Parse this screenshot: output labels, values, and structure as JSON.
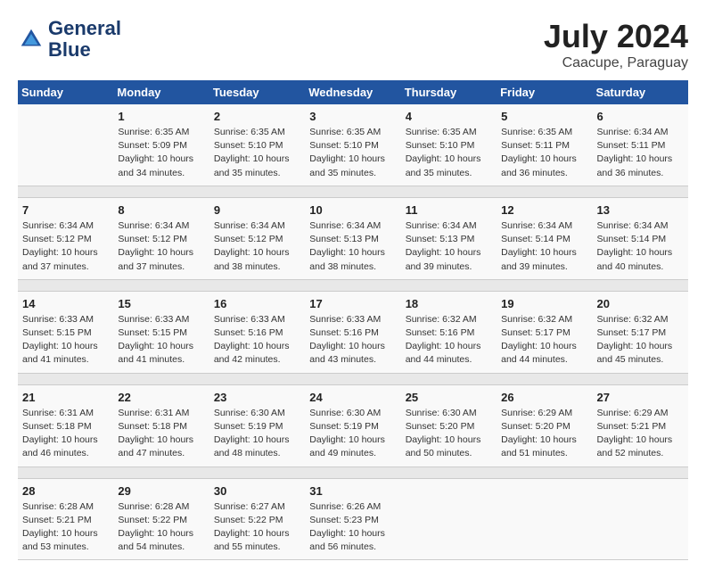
{
  "header": {
    "logo_line1": "General",
    "logo_line2": "Blue",
    "month": "July 2024",
    "location": "Caacupe, Paraguay"
  },
  "weekdays": [
    "Sunday",
    "Monday",
    "Tuesday",
    "Wednesday",
    "Thursday",
    "Friday",
    "Saturday"
  ],
  "weeks": [
    [
      {
        "day": "",
        "info": ""
      },
      {
        "day": "1",
        "info": "Sunrise: 6:35 AM\nSunset: 5:09 PM\nDaylight: 10 hours\nand 34 minutes."
      },
      {
        "day": "2",
        "info": "Sunrise: 6:35 AM\nSunset: 5:10 PM\nDaylight: 10 hours\nand 35 minutes."
      },
      {
        "day": "3",
        "info": "Sunrise: 6:35 AM\nSunset: 5:10 PM\nDaylight: 10 hours\nand 35 minutes."
      },
      {
        "day": "4",
        "info": "Sunrise: 6:35 AM\nSunset: 5:10 PM\nDaylight: 10 hours\nand 35 minutes."
      },
      {
        "day": "5",
        "info": "Sunrise: 6:35 AM\nSunset: 5:11 PM\nDaylight: 10 hours\nand 36 minutes."
      },
      {
        "day": "6",
        "info": "Sunrise: 6:34 AM\nSunset: 5:11 PM\nDaylight: 10 hours\nand 36 minutes."
      }
    ],
    [
      {
        "day": "7",
        "info": "Sunrise: 6:34 AM\nSunset: 5:12 PM\nDaylight: 10 hours\nand 37 minutes."
      },
      {
        "day": "8",
        "info": "Sunrise: 6:34 AM\nSunset: 5:12 PM\nDaylight: 10 hours\nand 37 minutes."
      },
      {
        "day": "9",
        "info": "Sunrise: 6:34 AM\nSunset: 5:12 PM\nDaylight: 10 hours\nand 38 minutes."
      },
      {
        "day": "10",
        "info": "Sunrise: 6:34 AM\nSunset: 5:13 PM\nDaylight: 10 hours\nand 38 minutes."
      },
      {
        "day": "11",
        "info": "Sunrise: 6:34 AM\nSunset: 5:13 PM\nDaylight: 10 hours\nand 39 minutes."
      },
      {
        "day": "12",
        "info": "Sunrise: 6:34 AM\nSunset: 5:14 PM\nDaylight: 10 hours\nand 39 minutes."
      },
      {
        "day": "13",
        "info": "Sunrise: 6:34 AM\nSunset: 5:14 PM\nDaylight: 10 hours\nand 40 minutes."
      }
    ],
    [
      {
        "day": "14",
        "info": "Sunrise: 6:33 AM\nSunset: 5:15 PM\nDaylight: 10 hours\nand 41 minutes."
      },
      {
        "day": "15",
        "info": "Sunrise: 6:33 AM\nSunset: 5:15 PM\nDaylight: 10 hours\nand 41 minutes."
      },
      {
        "day": "16",
        "info": "Sunrise: 6:33 AM\nSunset: 5:16 PM\nDaylight: 10 hours\nand 42 minutes."
      },
      {
        "day": "17",
        "info": "Sunrise: 6:33 AM\nSunset: 5:16 PM\nDaylight: 10 hours\nand 43 minutes."
      },
      {
        "day": "18",
        "info": "Sunrise: 6:32 AM\nSunset: 5:16 PM\nDaylight: 10 hours\nand 44 minutes."
      },
      {
        "day": "19",
        "info": "Sunrise: 6:32 AM\nSunset: 5:17 PM\nDaylight: 10 hours\nand 44 minutes."
      },
      {
        "day": "20",
        "info": "Sunrise: 6:32 AM\nSunset: 5:17 PM\nDaylight: 10 hours\nand 45 minutes."
      }
    ],
    [
      {
        "day": "21",
        "info": "Sunrise: 6:31 AM\nSunset: 5:18 PM\nDaylight: 10 hours\nand 46 minutes."
      },
      {
        "day": "22",
        "info": "Sunrise: 6:31 AM\nSunset: 5:18 PM\nDaylight: 10 hours\nand 47 minutes."
      },
      {
        "day": "23",
        "info": "Sunrise: 6:30 AM\nSunset: 5:19 PM\nDaylight: 10 hours\nand 48 minutes."
      },
      {
        "day": "24",
        "info": "Sunrise: 6:30 AM\nSunset: 5:19 PM\nDaylight: 10 hours\nand 49 minutes."
      },
      {
        "day": "25",
        "info": "Sunrise: 6:30 AM\nSunset: 5:20 PM\nDaylight: 10 hours\nand 50 minutes."
      },
      {
        "day": "26",
        "info": "Sunrise: 6:29 AM\nSunset: 5:20 PM\nDaylight: 10 hours\nand 51 minutes."
      },
      {
        "day": "27",
        "info": "Sunrise: 6:29 AM\nSunset: 5:21 PM\nDaylight: 10 hours\nand 52 minutes."
      }
    ],
    [
      {
        "day": "28",
        "info": "Sunrise: 6:28 AM\nSunset: 5:21 PM\nDaylight: 10 hours\nand 53 minutes."
      },
      {
        "day": "29",
        "info": "Sunrise: 6:28 AM\nSunset: 5:22 PM\nDaylight: 10 hours\nand 54 minutes."
      },
      {
        "day": "30",
        "info": "Sunrise: 6:27 AM\nSunset: 5:22 PM\nDaylight: 10 hours\nand 55 minutes."
      },
      {
        "day": "31",
        "info": "Sunrise: 6:26 AM\nSunset: 5:23 PM\nDaylight: 10 hours\nand 56 minutes."
      },
      {
        "day": "",
        "info": ""
      },
      {
        "day": "",
        "info": ""
      },
      {
        "day": "",
        "info": ""
      }
    ]
  ]
}
